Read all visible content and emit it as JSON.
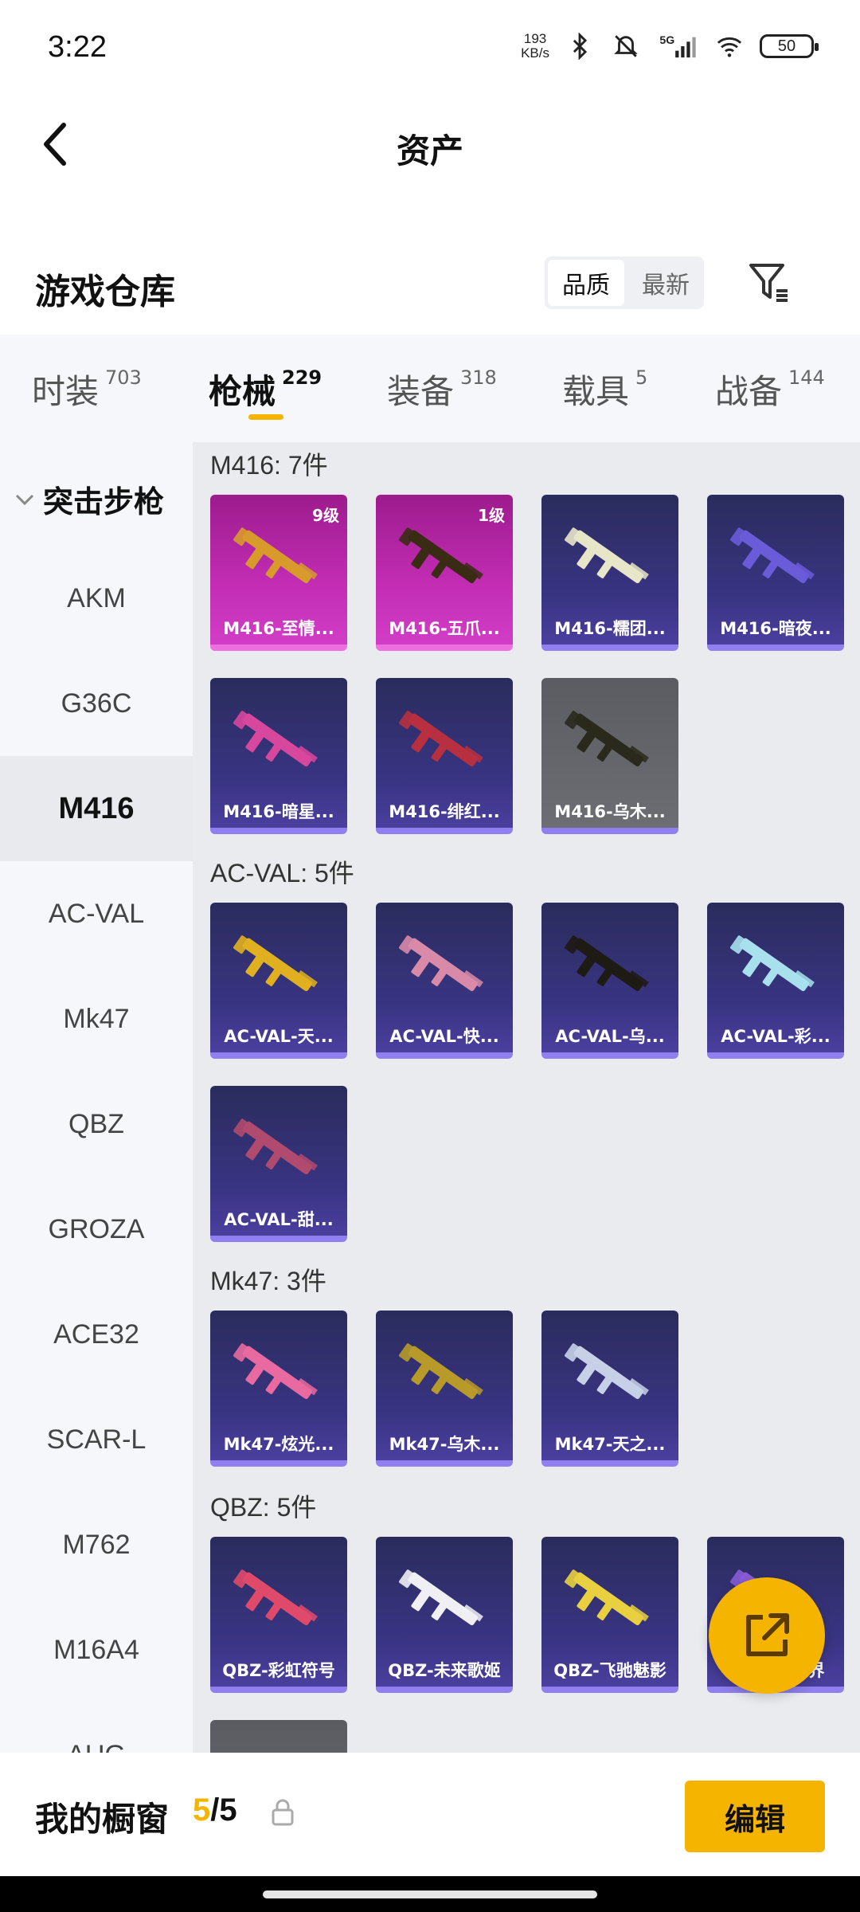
{
  "status_bar": {
    "time": "3:22",
    "net_speed_value": "193",
    "net_speed_unit": "KB/s",
    "network": "5G",
    "battery": "50",
    "icons": [
      "bluetooth-icon",
      "mute-icon",
      "signal-icon",
      "wifi-icon",
      "battery-icon"
    ]
  },
  "header": {
    "title": "资产"
  },
  "warehouse": {
    "title": "游戏仓库",
    "sort_options": [
      "品质",
      "最新"
    ],
    "active_sort": "品质"
  },
  "tabs": [
    {
      "label": "时装",
      "count": "703"
    },
    {
      "label": "枪械",
      "count": "229",
      "active": true
    },
    {
      "label": "装备",
      "count": "318"
    },
    {
      "label": "载具",
      "count": "5"
    },
    {
      "label": "战备",
      "count": "144"
    }
  ],
  "sidebar": {
    "group": "突击步枪",
    "items": [
      "AKM",
      "G36C",
      "M416",
      "AC-VAL",
      "Mk47",
      "QBZ",
      "GROZA",
      "ACE32",
      "SCAR-L",
      "M762",
      "M16A4",
      "AUG"
    ],
    "active": "M416"
  },
  "sections": [
    {
      "title": "M416: 7件",
      "cards": [
        {
          "label": "M416-至情...",
          "level": "9级",
          "style": "pink",
          "gun_color": "#d79a2b"
        },
        {
          "label": "M416-五爪...",
          "level": "1级",
          "style": "pink",
          "gun_color": "#3a2c14"
        },
        {
          "label": "M416-糯团...",
          "level": "",
          "style": "blue",
          "gun_color": "#e8e6c8"
        },
        {
          "label": "M416-暗夜...",
          "level": "",
          "style": "blue",
          "gun_color": "#6a5bd8"
        },
        {
          "label": "M416-暗星...",
          "level": "",
          "style": "blue",
          "gun_color": "#d8479e"
        },
        {
          "label": "M416-绯红...",
          "level": "",
          "style": "blue",
          "gun_color": "#b83040"
        },
        {
          "label": "M416-乌木...",
          "level": "",
          "style": "gray",
          "gun_color": "#2a2a1c"
        }
      ]
    },
    {
      "title": "AC-VAL: 5件",
      "cards": [
        {
          "label": "AC-VAL-天...",
          "level": "",
          "style": "blue",
          "gun_color": "#e0b020"
        },
        {
          "label": "AC-VAL-快...",
          "level": "",
          "style": "blue",
          "gun_color": "#d88aa8"
        },
        {
          "label": "AC-VAL-乌...",
          "level": "",
          "style": "blue",
          "gun_color": "#1e1a14"
        },
        {
          "label": "AC-VAL-彩...",
          "level": "",
          "style": "blue",
          "gun_color": "#a8e0ee"
        },
        {
          "label": "AC-VAL-甜...",
          "level": "",
          "style": "blue",
          "gun_color": "#b04a6e"
        }
      ]
    },
    {
      "title": "Mk47: 3件",
      "cards": [
        {
          "label": "Mk47-炫光...",
          "level": "",
          "style": "blue",
          "gun_color": "#e86aa0"
        },
        {
          "label": "Mk47-乌木...",
          "level": "",
          "style": "blue",
          "gun_color": "#b89a2a"
        },
        {
          "label": "Mk47-天之...",
          "level": "",
          "style": "blue",
          "gun_color": "#c8d0e8"
        }
      ]
    },
    {
      "title": "QBZ: 5件",
      "cards": [
        {
          "label": "QBZ-彩虹符号",
          "level": "",
          "style": "blue",
          "gun_color": "#e04a6a"
        },
        {
          "label": "QBZ-未来歌姬",
          "level": "",
          "style": "blue",
          "gun_color": "#f0f0f4"
        },
        {
          "label": "QBZ-飞驰魅影",
          "level": "",
          "style": "blue",
          "gun_color": "#e8d040"
        },
        {
          "label": "QBZ-...视界",
          "level": "",
          "style": "blue",
          "gun_color": "#8a5bd8"
        },
        {
          "label": "",
          "level": "",
          "style": "gray",
          "gun_color": "#2a2a2a"
        }
      ]
    }
  ],
  "bottom": {
    "label": "我的橱窗",
    "count_used": "5",
    "count_total": "/5",
    "edit_label": "编辑"
  },
  "colors": {
    "accent": "#f5b400",
    "card_blue": "#3a3484",
    "card_pink": "#c22db4"
  }
}
